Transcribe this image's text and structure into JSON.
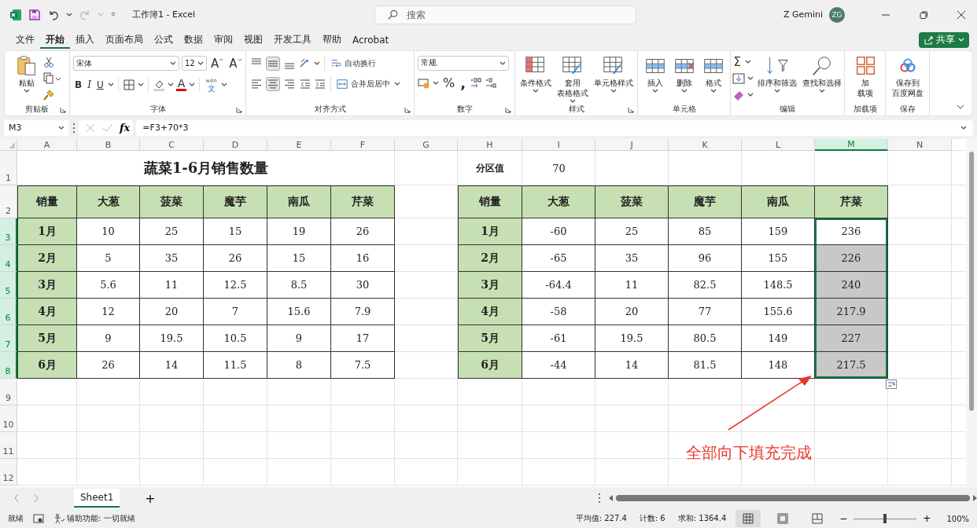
{
  "titlebar": {
    "title": "工作簿1  -  Excel",
    "search_placeholder": "搜索",
    "user": "Z Gemini",
    "avatar": "ZG"
  },
  "menu": [
    {
      "label": "文件",
      "selected": false
    },
    {
      "label": "开始",
      "selected": true
    },
    {
      "label": "插入",
      "selected": false
    },
    {
      "label": "页面布局",
      "selected": false
    },
    {
      "label": "公式",
      "selected": false
    },
    {
      "label": "数据",
      "selected": false
    },
    {
      "label": "审阅",
      "selected": false
    },
    {
      "label": "视图",
      "selected": false
    },
    {
      "label": "开发工具",
      "selected": false
    },
    {
      "label": "帮助",
      "selected": false
    },
    {
      "label": "Acrobat",
      "selected": false
    }
  ],
  "share_button": "共享",
  "ribbon": {
    "clipboard": {
      "label": "剪贴板",
      "paste": "粘贴"
    },
    "font": {
      "label": "字体",
      "font_name": "宋体",
      "font_size": "12",
      "grow": "A",
      "shrink": "A",
      "bold": "B",
      "italic": "I",
      "underline": "U",
      "font_color": "A",
      "phonetic_top": "wén",
      "phonetic_bottom": "文"
    },
    "alignment": {
      "label": "对齐方式",
      "wrap": "自动换行",
      "merge": "合并后居中",
      "vertical": [
        {
          "kind": "top",
          "selected": false
        },
        {
          "kind": "middle",
          "selected": true
        },
        {
          "kind": "bottom",
          "selected": false
        }
      ],
      "horizontal": [
        {
          "kind": "left",
          "selected": false
        },
        {
          "kind": "center",
          "selected": true
        },
        {
          "kind": "right",
          "selected": false
        }
      ]
    },
    "number": {
      "label": "数字",
      "format": "常规",
      "percent": "%",
      "comma": ","
    },
    "styles": {
      "label": "样式",
      "buttons": [
        [
          "条件格式"
        ],
        [
          "套用",
          "表格格式"
        ],
        [
          "单元格样式"
        ]
      ]
    },
    "cells": {
      "label": "单元格",
      "buttons": [
        "插入",
        "删除",
        "格式"
      ]
    },
    "editing": {
      "label": "编辑",
      "sum": "Σ",
      "buttons": [
        "排序和筛选",
        "查找和选择"
      ]
    },
    "addins": {
      "label": "加载项",
      "button": [
        "加",
        "载项"
      ]
    },
    "save": {
      "label": "保存",
      "button": [
        "保存到",
        "百度网盘"
      ]
    }
  },
  "formula_bar": {
    "name_box": "M3",
    "fx": "fx",
    "formula": "=F3+70*3"
  },
  "sheet": {
    "columns": [
      {
        "label": "A",
        "selected": false
      },
      {
        "label": "B",
        "selected": false
      },
      {
        "label": "C",
        "selected": false
      },
      {
        "label": "D",
        "selected": false
      },
      {
        "label": "E",
        "selected": false
      },
      {
        "label": "F",
        "selected": false
      },
      {
        "label": "G",
        "selected": false
      },
      {
        "label": "H",
        "selected": false
      },
      {
        "label": "I",
        "selected": false
      },
      {
        "label": "J",
        "selected": false
      },
      {
        "label": "K",
        "selected": false
      },
      {
        "label": "L",
        "selected": false
      },
      {
        "label": "M",
        "selected": true
      },
      {
        "label": "N",
        "selected": false
      }
    ],
    "row_numbers": [
      {
        "label": "1",
        "selected": false
      },
      {
        "label": "2",
        "selected": false
      },
      {
        "label": "3",
        "selected": true
      },
      {
        "label": "4",
        "selected": true
      },
      {
        "label": "5",
        "selected": true
      },
      {
        "label": "6",
        "selected": true
      },
      {
        "label": "7",
        "selected": true
      },
      {
        "label": "8",
        "selected": true
      },
      {
        "label": "9",
        "selected": false
      },
      {
        "label": "10",
        "selected": false
      },
      {
        "label": "11",
        "selected": false
      },
      {
        "label": "12",
        "selected": false
      }
    ],
    "title": "蔬菜1-6月销售数量",
    "partition_label": "分区值",
    "partition_value": "70",
    "left_table": {
      "header": [
        "销量",
        "大葱",
        "菠菜",
        "魔芋",
        "南瓜",
        "芹菜"
      ],
      "rows": [
        [
          "1月",
          "10",
          "25",
          "15",
          "19",
          "26"
        ],
        [
          "2月",
          "5",
          "35",
          "26",
          "15",
          "16"
        ],
        [
          "3月",
          "5.6",
          "11",
          "12.5",
          "8.5",
          "30"
        ],
        [
          "4月",
          "12",
          "20",
          "7",
          "15.6",
          "7.9"
        ],
        [
          "5月",
          "9",
          "19.5",
          "10.5",
          "9",
          "17"
        ],
        [
          "6月",
          "26",
          "14",
          "11.5",
          "8",
          "7.5"
        ]
      ]
    },
    "right_table": {
      "header": [
        "销量",
        "大葱",
        "菠菜",
        "魔芋",
        "南瓜",
        "芹菜"
      ],
      "rows": [
        {
          "cells": [
            {
              "text": "1月",
              "selected": false
            },
            {
              "text": "-60",
              "selected": false
            },
            {
              "text": "25",
              "selected": false
            },
            {
              "text": "85",
              "selected": false
            },
            {
              "text": "159",
              "selected": false
            },
            {
              "text": "236",
              "selected": true
            }
          ]
        },
        {
          "cells": [
            {
              "text": "2月",
              "selected": false
            },
            {
              "text": "-65",
              "selected": false
            },
            {
              "text": "35",
              "selected": false
            },
            {
              "text": "96",
              "selected": false
            },
            {
              "text": "155",
              "selected": false
            },
            {
              "text": "226",
              "selected": true
            }
          ]
        },
        {
          "cells": [
            {
              "text": "3月",
              "selected": false
            },
            {
              "text": "-64.4",
              "selected": false
            },
            {
              "text": "11",
              "selected": false
            },
            {
              "text": "82.5",
              "selected": false
            },
            {
              "text": "148.5",
              "selected": false
            },
            {
              "text": "240",
              "selected": true
            }
          ]
        },
        {
          "cells": [
            {
              "text": "4月",
              "selected": false
            },
            {
              "text": "-58",
              "selected": false
            },
            {
              "text": "20",
              "selected": false
            },
            {
              "text": "77",
              "selected": false
            },
            {
              "text": "155.6",
              "selected": false
            },
            {
              "text": "217.9",
              "selected": true
            }
          ]
        },
        {
          "cells": [
            {
              "text": "5月",
              "selected": false
            },
            {
              "text": "-61",
              "selected": false
            },
            {
              "text": "19.5",
              "selected": false
            },
            {
              "text": "80.5",
              "selected": false
            },
            {
              "text": "149",
              "selected": false
            },
            {
              "text": "227",
              "selected": true
            }
          ]
        },
        {
          "cells": [
            {
              "text": "6月",
              "selected": false
            },
            {
              "text": "-44",
              "selected": false
            },
            {
              "text": "14",
              "selected": false
            },
            {
              "text": "81.5",
              "selected": false
            },
            {
              "text": "148",
              "selected": false
            },
            {
              "text": "217.5",
              "selected": true
            }
          ]
        }
      ]
    },
    "annotation": "全部向下填充完成"
  },
  "sheet_tabs": {
    "tabs": [
      {
        "label": "Sheet1",
        "selected": true
      }
    ],
    "add": "+"
  },
  "status_bar": {
    "ready": "就绪",
    "accessibility": "辅助功能: 一切就绪",
    "stats": [
      "平均值: 227.4",
      "计数: 6",
      "求和: 1364.4"
    ],
    "views": [
      {
        "kind": "normal",
        "selected": true
      },
      {
        "kind": "page_layout",
        "selected": false
      },
      {
        "kind": "page_break",
        "selected": false
      }
    ],
    "zoom_out": "−",
    "zoom_in": "+",
    "zoom_slider": {
      "level": 0.5
    },
    "zoom": "100%"
  }
}
